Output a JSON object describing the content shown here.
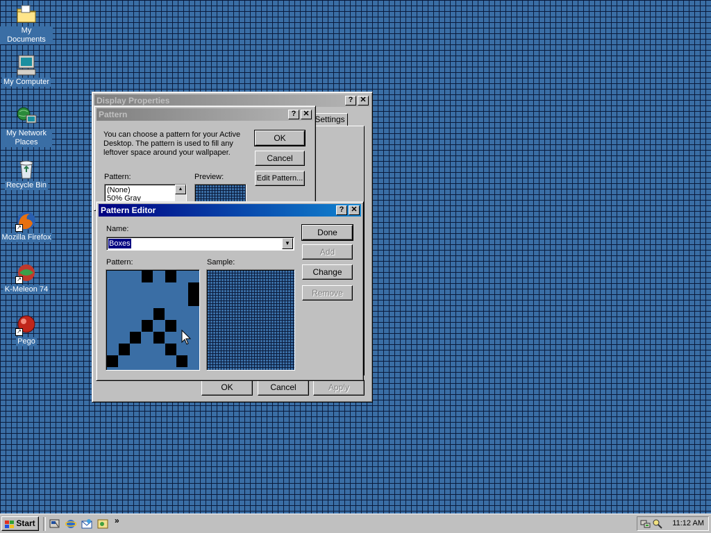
{
  "desktop": {
    "icons": [
      {
        "label": "My Documents",
        "icon": "folder-icon"
      },
      {
        "label": "My Computer",
        "icon": "computer-icon"
      },
      {
        "label": "My Network Places",
        "icon": "network-icon"
      },
      {
        "label": "Recycle Bin",
        "icon": "recycle-bin-icon"
      },
      {
        "label": "Mozilla Firefox",
        "icon": "firefox-icon"
      },
      {
        "label": "K-Meleon 74",
        "icon": "k-meleon-icon"
      },
      {
        "label": "Pego",
        "icon": "pego-icon"
      }
    ]
  },
  "display_properties": {
    "title": "Display Properties",
    "help": "?",
    "close": "✕",
    "tab_settings": "Settings",
    "ok": "OK",
    "cancel": "Cancel",
    "apply": "Apply"
  },
  "pattern_dialog": {
    "title": "Pattern",
    "help": "?",
    "close": "✕",
    "description": "You can choose a pattern for your Active Desktop.  The pattern is used to fill any leftover space around your wallpaper.",
    "pattern_label": "Pattern:",
    "preview_label": "Preview:",
    "list_items": [
      "(None)",
      "50% Gray"
    ],
    "ok": "OK",
    "cancel": "Cancel",
    "edit_pattern": "Edit Pattern..."
  },
  "pattern_editor": {
    "title": "Pattern Editor",
    "help": "?",
    "close": "✕",
    "name_label": "Name:",
    "name_value": "Boxes",
    "pattern_label": "Pattern:",
    "sample_label": "Sample:",
    "done": "Done",
    "add": "Add",
    "change": "Change",
    "remove": "Remove"
  },
  "taskbar": {
    "start": "Start",
    "clock": "11:12 AM",
    "more": "»",
    "quick_launch": [
      "show-desktop-icon",
      "internet-explorer-icon",
      "outlook-express-icon",
      "channels-icon"
    ]
  },
  "colors": {
    "desktop": "#3a6ea5",
    "face": "#c0c0c0",
    "active_title": "#000080",
    "inactive_title": "#808080"
  }
}
